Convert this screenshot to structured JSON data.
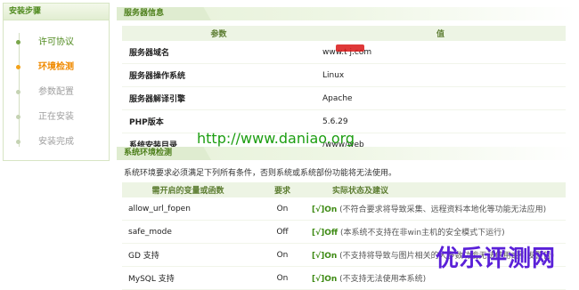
{
  "sidebar": {
    "title": "安装步骤",
    "steps": [
      {
        "label": "许可协议",
        "state": "done"
      },
      {
        "label": "环境检测",
        "state": "current"
      },
      {
        "label": "参数配置",
        "state": "pending"
      },
      {
        "label": "正在安装",
        "state": "pending"
      },
      {
        "label": "安装完成",
        "state": "pending"
      }
    ]
  },
  "server_info": {
    "title": "服务器信息",
    "columns": [
      "参数",
      "值"
    ],
    "rows": [
      {
        "key": "服务器域名",
        "value": "www.t   j.com"
      },
      {
        "key": "服务器操作系统",
        "value": "Linux"
      },
      {
        "key": "服务器解译引擎",
        "value": "Apache"
      },
      {
        "key": "PHP版本",
        "value": "5.6.29"
      },
      {
        "key": "系统安装目录",
        "value": "/www/web"
      }
    ]
  },
  "env_check": {
    "title": "系统环境检测",
    "description": "系统环境要求必须满足下列所有条件，否则系统或系统部份功能将无法使用。",
    "columns": [
      "需开启的变量或函数",
      "要求",
      "实际状态及建议"
    ],
    "rows": [
      {
        "name": "allow_url_fopen",
        "required": "On",
        "status": "[√]On",
        "note": "(不符合要求将导致采集、远程资料本地化等功能无法应用)"
      },
      {
        "name": "safe_mode",
        "required": "Off",
        "status": "[√]Off",
        "note": "(本系统不支持在非win主机的安全模式下运行)"
      },
      {
        "name": "GD 支持",
        "required": "On",
        "status": "[√]On",
        "note": "(不支持将导致与图片相关的大多数功能无法使用或引发警告)"
      },
      {
        "name": "MySQL 支持",
        "required": "On",
        "status": "[√]On",
        "note": "(不支持无法使用本系统)"
      }
    ]
  },
  "overlay": {
    "watermark_url": "http://www.daniao.org",
    "brand": "优乐评测网"
  },
  "colors": {
    "accent_green": "#4f8a1e",
    "current_step": "#f08a00",
    "status_ok": "#3d8a13",
    "brand_purple": "#5a20d8"
  }
}
